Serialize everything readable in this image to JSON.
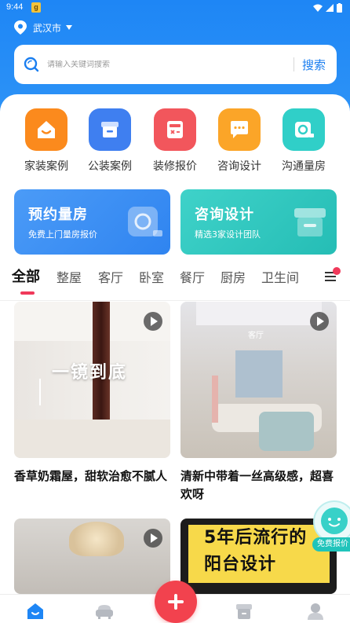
{
  "status_bar": {
    "time": "9:44",
    "notification_badge": "g"
  },
  "location": {
    "city": "武汉市"
  },
  "search": {
    "placeholder": "请输入关键词搜索",
    "button_label": "搜索"
  },
  "categories": [
    {
      "label": "家装案例",
      "icon": "house-icon",
      "color": "#fb8a1d"
    },
    {
      "label": "公装案例",
      "icon": "store-icon",
      "color": "#3f7ff0"
    },
    {
      "label": "装修报价",
      "icon": "calculator-icon",
      "color": "#f2565c"
    },
    {
      "label": "咨询设计",
      "icon": "chat-icon",
      "color": "#fba528"
    },
    {
      "label": "沟通量房",
      "icon": "tape-measure-icon",
      "color": "#30cfc8"
    }
  ],
  "banners": [
    {
      "title": "预约量房",
      "subtitle": "免费上门量房报价",
      "color": "#3d8ff3"
    },
    {
      "title": "咨询设计",
      "subtitle": "精选3家设计团队",
      "color": "#2dc5bd"
    }
  ],
  "tabs": [
    "全部",
    "整屋",
    "客厅",
    "卧室",
    "餐厅",
    "厨房",
    "卫生间"
  ],
  "feed": [
    {
      "title": "香草奶霜屋，甜软治愈不腻人",
      "overlay_text": "一镜到底",
      "has_video": true
    },
    {
      "title": "清新中带着一丝高级感，超喜欢呀",
      "overlay_text": "客厅",
      "has_video": true
    },
    {
      "title": "",
      "overlay_text": "",
      "has_video": true
    },
    {
      "title": "",
      "overlay_text": "5年后流行的 阳台设计",
      "has_video": false
    }
  ],
  "float_button": {
    "label": "免费报价"
  },
  "bottom_nav": [
    "home-icon",
    "sofa-icon",
    "add-icon",
    "shop-icon",
    "profile-icon"
  ],
  "colors": {
    "primary": "#1e86f5",
    "accent": "#f0395a"
  }
}
